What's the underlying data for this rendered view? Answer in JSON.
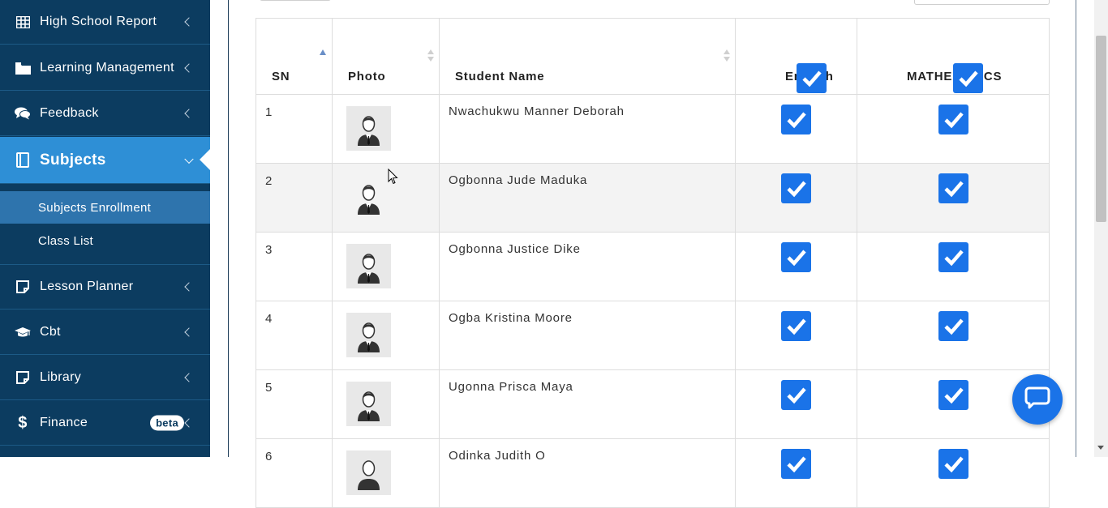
{
  "sidebar": {
    "items": [
      {
        "label": "High School Report",
        "icon": "table-icon"
      },
      {
        "label": "Learning Management",
        "icon": "folder-icon"
      },
      {
        "label": "Feedback",
        "icon": "comments-icon"
      },
      {
        "label": "Subjects",
        "icon": "book-icon",
        "active": true
      },
      {
        "label": "Lesson Planner",
        "icon": "note-icon"
      },
      {
        "label": "Cbt",
        "icon": "graduation-cap-icon"
      },
      {
        "label": "Library",
        "icon": "note-icon"
      },
      {
        "label": "Finance",
        "icon": "dollar-icon",
        "badge": "beta"
      }
    ],
    "subitems": [
      {
        "label": "Subjects Enrollment",
        "active": true
      },
      {
        "label": "Class List"
      }
    ]
  },
  "table": {
    "headers": {
      "sn": "SN",
      "photo": "Photo",
      "name": "Student Name",
      "english": "English",
      "math": "MATHEMATICS"
    },
    "rows": [
      {
        "sn": "1",
        "name": "Nwachukwu Manner Deborah",
        "english": true,
        "math": true
      },
      {
        "sn": "2",
        "name": "Ogbonna Jude Maduka",
        "english": true,
        "math": true
      },
      {
        "sn": "3",
        "name": "Ogbonna Justice Dike",
        "english": true,
        "math": true
      },
      {
        "sn": "4",
        "name": "Ogba Kristina Moore",
        "english": true,
        "math": true
      },
      {
        "sn": "5",
        "name": "Ugonna Prisca Maya",
        "english": true,
        "math": true
      },
      {
        "sn": "6",
        "name": "Odinka Judith O",
        "english": true,
        "math": true
      }
    ]
  },
  "colors": {
    "sidebar": "#0c3c60",
    "active": "#2e8fd6",
    "checkbox": "#1a73e8"
  },
  "icons": {
    "chat": "chat-bubble-icon",
    "avatar": "student-avatar-icon"
  }
}
